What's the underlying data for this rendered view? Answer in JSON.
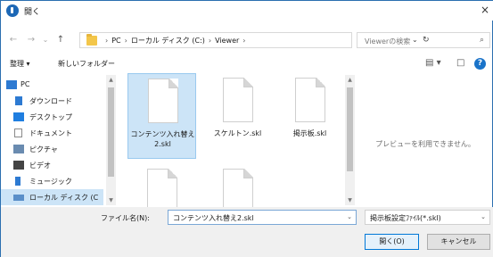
{
  "window": {
    "title": "開く",
    "close_glyph": "×"
  },
  "nav": {
    "back_glyph": "←",
    "forward_glyph": "→",
    "dropdown_glyph": "⌄",
    "up_glyph": "↑",
    "breadcrumbs": [
      "PC",
      "ローカル ディスク (C:)",
      "Viewer"
    ],
    "crumb_separator": "›",
    "address_dropdown_glyph": "⌄",
    "refresh_glyph": "↻",
    "search_placeholder": "Viewerの検索",
    "search_glyph": "⌕"
  },
  "toolbar": {
    "organize": "整理 ▾",
    "new_folder": "新しいフォルダー",
    "view_glyph": "▤ ▾",
    "pane_glyph": "□",
    "help_glyph": "?"
  },
  "sidebar": {
    "items": [
      {
        "label": "PC",
        "icon": "pc-icon",
        "color": "#2d7ad2"
      },
      {
        "label": "ダウンロード",
        "icon": "download-icon",
        "color": "#2d7ad2"
      },
      {
        "label": "デスクトップ",
        "icon": "desktop-icon",
        "color": "#1f7ee0"
      },
      {
        "label": "ドキュメント",
        "icon": "documents-icon",
        "color": "#8a8a8a"
      },
      {
        "label": "ピクチャ",
        "icon": "pictures-icon",
        "color": "#6a8bb0"
      },
      {
        "label": "ビデオ",
        "icon": "videos-icon",
        "color": "#444444"
      },
      {
        "label": "ミュージック",
        "icon": "music-icon",
        "color": "#2d7ad2"
      },
      {
        "label": "ローカル ディスク (C",
        "icon": "drive-icon",
        "color": "#5a8fc9"
      }
    ]
  },
  "files": [
    {
      "name": "コンテンツ入れ替え2.skl",
      "selected": true
    },
    {
      "name": "スケルトン.skl",
      "selected": false
    },
    {
      "name": "掲示板.skl",
      "selected": false
    },
    {
      "name": "",
      "selected": false
    },
    {
      "name": "",
      "selected": false
    }
  ],
  "preview": {
    "message": "プレビューを利用できません。"
  },
  "footer": {
    "filename_label": "ファイル名(N):",
    "filename_value": "コンテンツ入れ替え2.skl",
    "filetype_value": "掲示板設定ﾌｧｲﾙ(*.skl)",
    "dropdown_glyph": "⌄",
    "open_button": "開く(O)",
    "cancel_button": "キャンセル"
  },
  "colors": {
    "accent": "#0078d7",
    "selection": "#cce4f7",
    "border": "#2b6fb0"
  }
}
